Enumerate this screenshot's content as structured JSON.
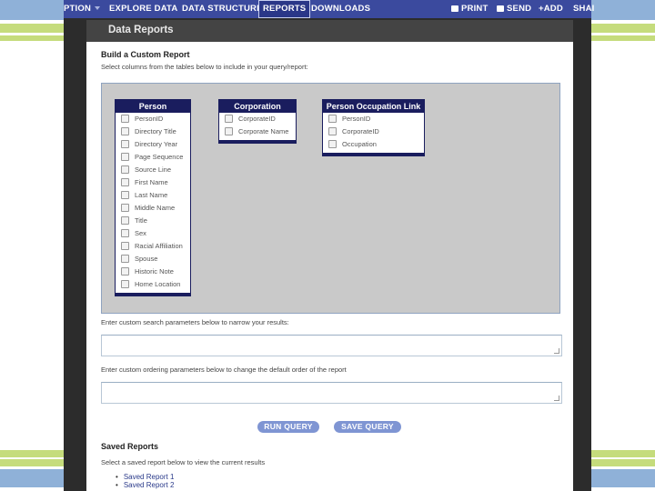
{
  "nav": {
    "items": [
      {
        "label": "PTION",
        "caret": true
      },
      {
        "label": "EXPLORE DATA"
      },
      {
        "label": "DATA STRUCTURE"
      },
      {
        "label": "REPORTS",
        "active": true
      },
      {
        "label": "DOWNLOADS"
      }
    ],
    "actions": [
      {
        "label": "PRINT",
        "icon": "printer-icon"
      },
      {
        "label": "SEND",
        "icon": "envelope-icon"
      },
      {
        "label": "ADD",
        "icon": "plus-icon"
      },
      {
        "label": "SHAI"
      }
    ]
  },
  "page": {
    "title": "Data Reports",
    "build_heading": "Build a Custom Report",
    "select_text": "Select columns from the tables below to include in your query/report:"
  },
  "tables": [
    {
      "name": "Person",
      "columns": [
        "PersonID",
        "Directory Title",
        "Directory Year",
        "Page Sequence",
        "Source Line",
        "First Name",
        "Last Name",
        "Middle Name",
        "Title",
        "Sex",
        "Racial Affiliation",
        "Spouse",
        "Historic Note",
        "Home Location"
      ]
    },
    {
      "name": "Corporation",
      "columns": [
        "CorporateID",
        "Corporate Name"
      ]
    },
    {
      "name": "Person Occupation Link",
      "columns": [
        "PersonID",
        "CorporateID",
        "Occupation"
      ]
    }
  ],
  "search_label": "Enter custom search parameters below to narrow your results:",
  "order_label": "Enter custom ordering parameters below to change the default order of the report",
  "buttons": {
    "run": "RUN QUERY",
    "save": "SAVE QUERY"
  },
  "saved": {
    "heading": "Saved Reports",
    "text": "Select a saved report below to view the current results",
    "items": [
      "Saved Report 1",
      "Saved Report 2"
    ]
  },
  "colors": {
    "nav": "#3b4a9e",
    "table_header": "#1a1d5e",
    "button": "#7f95d3",
    "stripe_blue": "#8fb1d8",
    "stripe_green": "#c5dc7c"
  }
}
